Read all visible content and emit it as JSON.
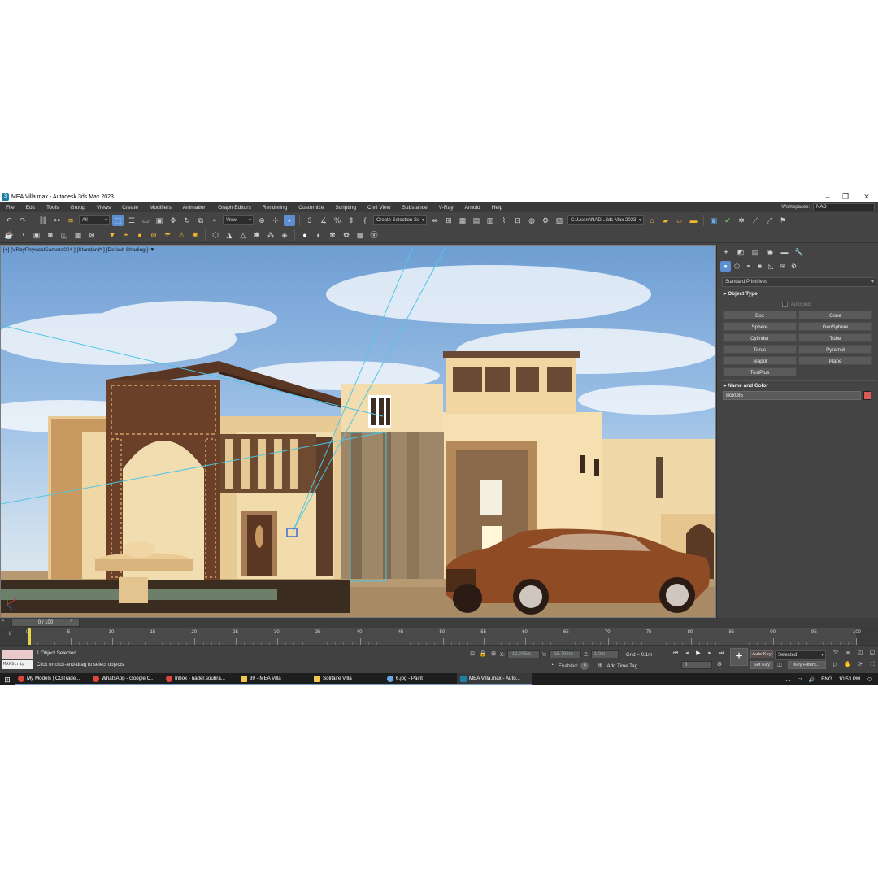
{
  "titlebar": {
    "title": "MEA Villa.max - Autodesk 3ds Max 2023",
    "app_icon": "3ds-max-icon",
    "minimize_icon": "minimize-icon",
    "maximize_icon": "restore-icon",
    "close_icon": "close-icon"
  },
  "menubar": {
    "items": [
      "File",
      "Edit",
      "Tools",
      "Group",
      "Views",
      "Create",
      "Modifiers",
      "Animation",
      "Graph Editors",
      "Rendering",
      "Customize",
      "Scripting",
      "Civil View",
      "Substance",
      "V-Ray",
      "Arnold",
      "Help"
    ],
    "workspaces_label": "Workspaces:",
    "workspaces_value": "NAD"
  },
  "main_toolbar": {
    "selection_filter": "All",
    "reference_coord": "View",
    "named_selection": "Create Selection Se",
    "project_path": "C:\\Users\\NAD...3ds Max 2023"
  },
  "viewport": {
    "label": "[+] [VRayPhysicalCamera004 ] [Standard* ] [Default Shading ]"
  },
  "command_panel": {
    "category": "Standard Primitives",
    "object_type_title": "Object Type",
    "autogrid_label": "AutoGrid",
    "buttons": [
      "Box",
      "Cone",
      "Sphere",
      "GeoSphere",
      "Cylinder",
      "Tube",
      "Torus",
      "Pyramid",
      "Teapot",
      "Plane",
      "TextPlus"
    ],
    "name_color_title": "Name and Color",
    "object_name": "Box085",
    "object_color": "#d85a5a"
  },
  "time_slider": {
    "frame_label": "0 / 100",
    "prev_label": "<",
    "next_label": ">"
  },
  "track_bar": {
    "ticks": [
      "0",
      "5",
      "10",
      "15",
      "20",
      "25",
      "30",
      "35",
      "40",
      "45",
      "50",
      "55",
      "60",
      "65",
      "70",
      "75",
      "80",
      "85",
      "90",
      "95",
      "100"
    ]
  },
  "status_bar": {
    "maxscript_label": "MAXScrip",
    "selection_status": "1 Object Selected",
    "prompt": "Click or click-and-drag to select objects",
    "x_label": "X:",
    "x_value": "-12.005m",
    "y_label": "Y:",
    "y_value": "-15.793m",
    "z_label": "Z:",
    "z_value": "1.0m",
    "grid_label": "Grid = 0.1m",
    "enabled_label": "Enabled:",
    "add_time_tag": "Add Time Tag",
    "frame_value": "0",
    "auto_key": "Auto Key",
    "set_key": "Set Key",
    "key_mode": "Selected",
    "key_filters": "Key Filters..."
  },
  "taskbar": {
    "items": [
      {
        "label": "My Models | CGTrade...",
        "color": "#e0453a"
      },
      {
        "label": "WhatsApp - Google C...",
        "color": "#e0453a"
      },
      {
        "label": "Inbox - nader.soubra...",
        "color": "#e0453a"
      },
      {
        "label": "39 - MEA Villa",
        "color": "#f2c94c"
      },
      {
        "label": "Solitaire Villa",
        "color": "#f2c94c"
      },
      {
        "label": "6.jpg - Paint",
        "color": "#6ba7e6"
      },
      {
        "label": "MEA Villa.max - Auto...",
        "color": "#1b7fa6"
      }
    ],
    "language": "ENG",
    "time": "10:53 PM"
  }
}
